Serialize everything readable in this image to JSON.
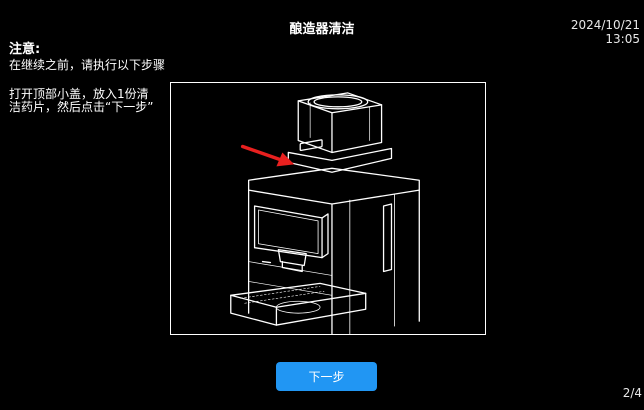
{
  "header": {
    "title": "酿造器清洁",
    "date": "2024/10/21",
    "time": "13:05"
  },
  "notice": {
    "heading": "注意:",
    "text": "在继续之前，请执行以下步骤"
  },
  "instruction": {
    "text": "打开顶部小盖，放入1份清洁药片，然后点击“下一步”"
  },
  "illustration": {
    "icon": "coffee-machine-illustration",
    "arrow_color": "#e8201f"
  },
  "actions": {
    "next_label": "下一步",
    "button_color": "#2196f3"
  },
  "footer": {
    "page_indicator": "2/4"
  }
}
